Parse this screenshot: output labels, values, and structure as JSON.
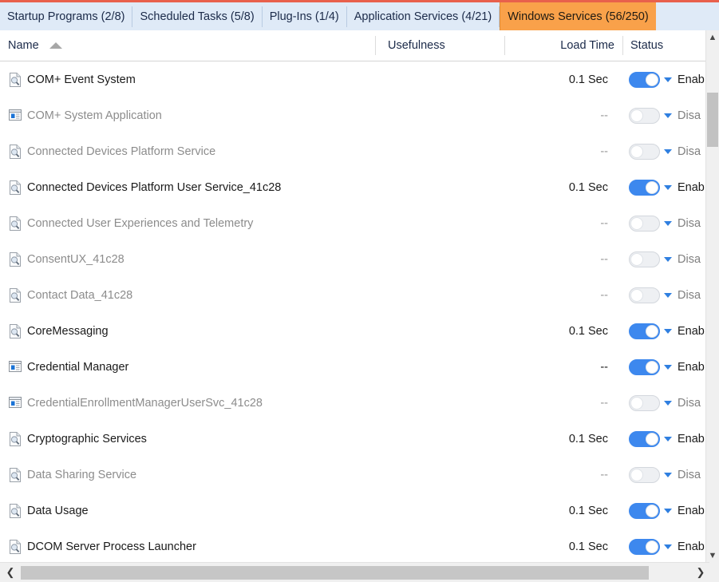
{
  "tabs": [
    {
      "label": "Startup Programs (2/8)",
      "active": false
    },
    {
      "label": "Scheduled Tasks (5/8)",
      "active": false
    },
    {
      "label": "Plug-Ins (1/4)",
      "active": false
    },
    {
      "label": "Application Services (4/21)",
      "active": false
    },
    {
      "label": "Windows Services (56/250)",
      "active": true
    }
  ],
  "columns": {
    "name": "Name",
    "usefulness": "Usefulness",
    "load_time": "Load Time",
    "status": "Status",
    "sort_direction": "ascending"
  },
  "colors": {
    "active_tab": "#f9a14a",
    "tabbar_bg": "#dfeaf7",
    "toggle_on": "#3d88ee",
    "toggle_off": "#eef0f3",
    "accent_line": "#e8604c"
  },
  "rows": [
    {
      "name": "COM+ Event System",
      "icon": "service-document-icon",
      "usefulness": "",
      "load_time": "0.1 Sec",
      "status": "Enab",
      "enabled": true
    },
    {
      "name": "COM+ System Application",
      "icon": "application-window-icon",
      "usefulness": "",
      "load_time": "--",
      "status": "Disa",
      "enabled": false
    },
    {
      "name": "Connected Devices Platform Service",
      "icon": "service-document-icon",
      "usefulness": "",
      "load_time": "--",
      "status": "Disa",
      "enabled": false
    },
    {
      "name": "Connected Devices Platform User Service_41c28",
      "icon": "service-document-icon",
      "usefulness": "",
      "load_time": "0.1 Sec",
      "status": "Enab",
      "enabled": true
    },
    {
      "name": "Connected User Experiences and Telemetry",
      "icon": "service-document-icon",
      "usefulness": "",
      "load_time": "--",
      "status": "Disa",
      "enabled": false
    },
    {
      "name": "ConsentUX_41c28",
      "icon": "service-document-icon",
      "usefulness": "",
      "load_time": "--",
      "status": "Disa",
      "enabled": false
    },
    {
      "name": "Contact Data_41c28",
      "icon": "service-document-icon",
      "usefulness": "",
      "load_time": "--",
      "status": "Disa",
      "enabled": false
    },
    {
      "name": "CoreMessaging",
      "icon": "service-document-icon",
      "usefulness": "",
      "load_time": "0.1 Sec",
      "status": "Enab",
      "enabled": true
    },
    {
      "name": "Credential Manager",
      "icon": "application-window-icon",
      "usefulness": "",
      "load_time": "--",
      "status": "Enab",
      "enabled": true
    },
    {
      "name": "CredentialEnrollmentManagerUserSvc_41c28",
      "icon": "application-window-icon",
      "usefulness": "",
      "load_time": "--",
      "status": "Disa",
      "enabled": false
    },
    {
      "name": "Cryptographic Services",
      "icon": "service-document-icon",
      "usefulness": "",
      "load_time": "0.1 Sec",
      "status": "Enab",
      "enabled": true
    },
    {
      "name": "Data Sharing Service",
      "icon": "service-document-icon",
      "usefulness": "",
      "load_time": "--",
      "status": "Disa",
      "enabled": false
    },
    {
      "name": "Data Usage",
      "icon": "service-document-icon",
      "usefulness": "",
      "load_time": "0.1 Sec",
      "status": "Enab",
      "enabled": true
    },
    {
      "name": "DCOM Server Process Launcher",
      "icon": "service-document-icon",
      "usefulness": "",
      "load_time": "0.1 Sec",
      "status": "Enab",
      "enabled": true
    }
  ],
  "scrollbars": {
    "vertical_up": "▲",
    "vertical_down": "▼",
    "horizontal_left": "❮",
    "horizontal_right": "❯"
  }
}
